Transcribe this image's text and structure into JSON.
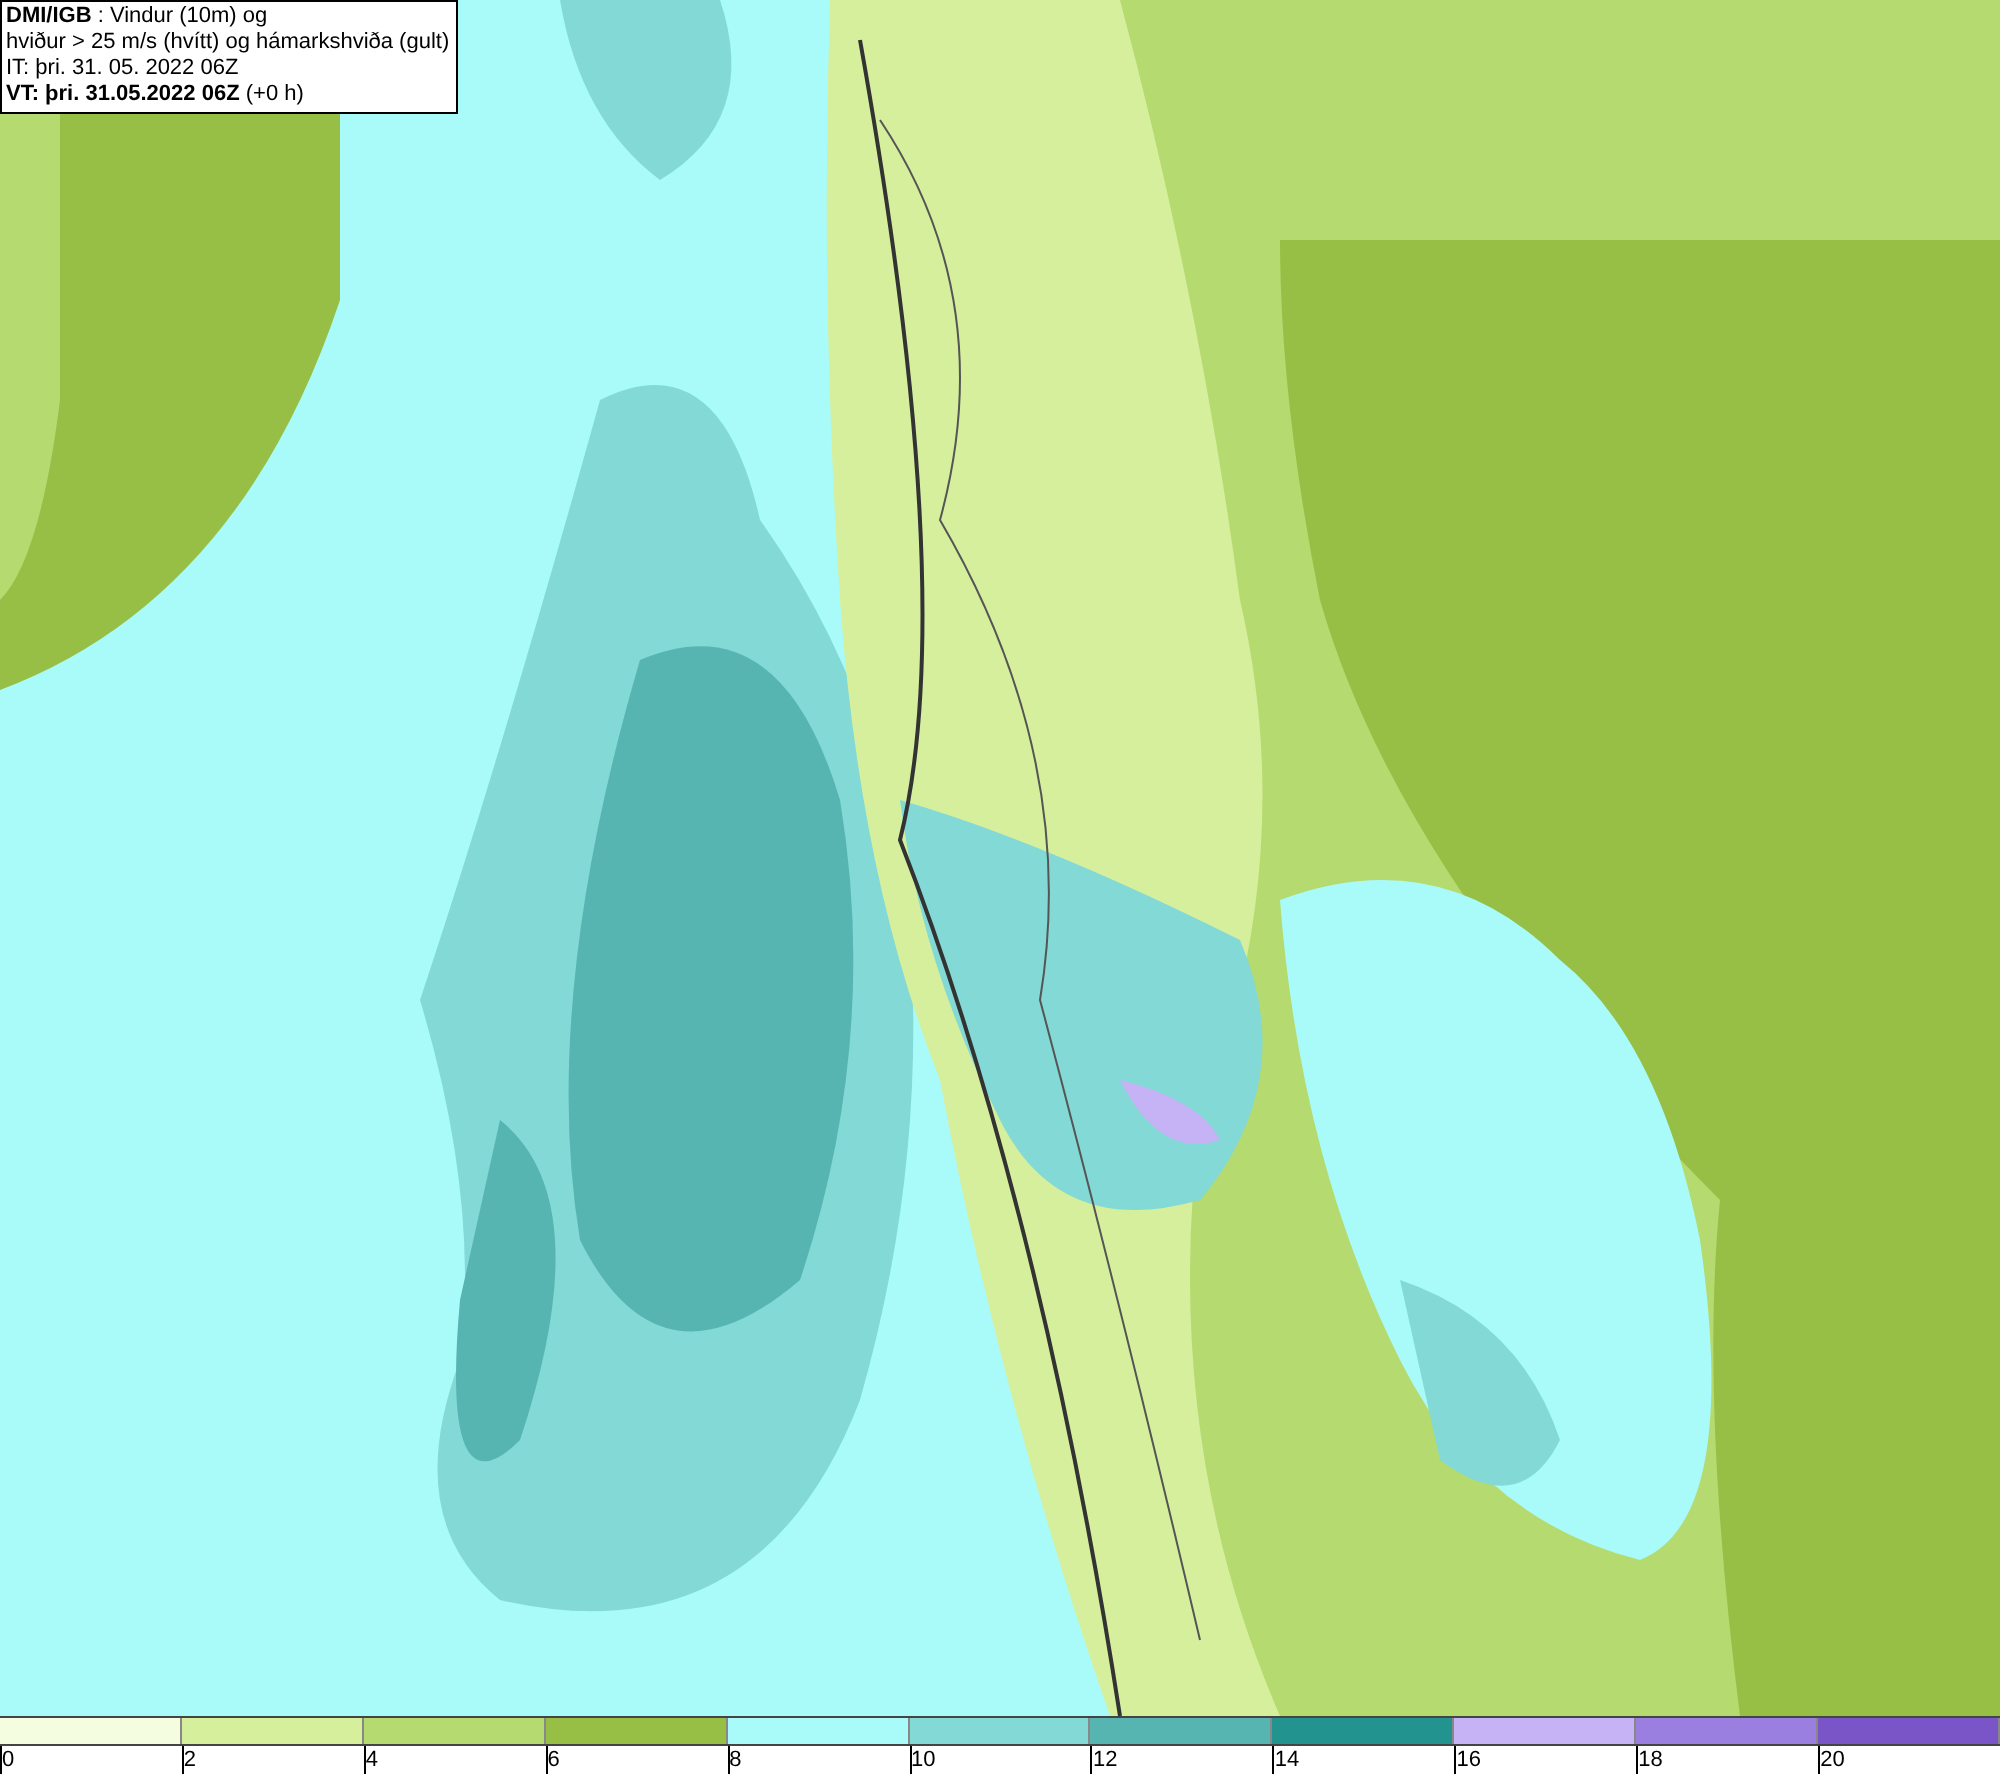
{
  "caption": {
    "lines": [
      "**DMI/IGB** : Vindur (10m) og",
      "hviður > 25 m/s (hvítt) og hámarkshviða (gult)",
      "IT: þri. 31. 05. 2022 06Z",
      "**VT: þri. 31.05.2022 06Z** (+0 h)"
    ]
  },
  "legend": {
    "segments": [
      {
        "color": "#f4fde0"
      },
      {
        "color": "#d6ef9c"
      },
      {
        "color": "#b5da6f"
      },
      {
        "color": "#97bf45"
      },
      {
        "color": "#a9fbfa"
      },
      {
        "color": "#82d9d6"
      },
      {
        "color": "#56b5b0"
      },
      {
        "color": "#22938e"
      },
      {
        "color": "#c5b3f6"
      },
      {
        "color": "#9b7fe0"
      },
      {
        "color": "#7a55c8"
      }
    ],
    "labels": [
      "0",
      "2",
      "4",
      "6",
      "8",
      "10",
      "12",
      "14",
      "16",
      "18",
      "20"
    ]
  }
}
